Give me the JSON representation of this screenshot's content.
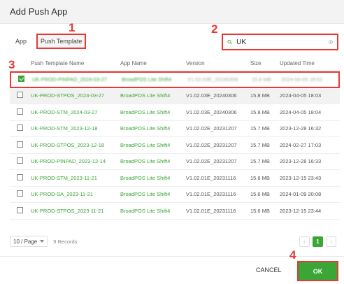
{
  "dialog": {
    "title": "Add Push App"
  },
  "tabs": [
    {
      "label": "App"
    },
    {
      "label": "Push Template"
    }
  ],
  "search": {
    "value": "UK"
  },
  "annotations": [
    "1",
    "2",
    "3",
    "4"
  ],
  "table": {
    "headers": [
      "Push Template Name",
      "App Name",
      "Version",
      "Size",
      "Updated Time"
    ],
    "rows": [
      {
        "name": "UK-PROD-PINPAD_2024-03-27",
        "app": "BroadPOS Lite Shift4",
        "version": "V1.02.03E_20240306",
        "size": "15.6 MB",
        "time": "2024-04-05 18:02",
        "checked": true
      },
      {
        "name": "UK-PROD-STPOS_2024-03-27",
        "app": "BroadPOS Lite Shift4",
        "version": "V1.02.03E_20240306",
        "size": "15.8 MB",
        "time": "2024-04-05 18:03",
        "checked": false
      },
      {
        "name": "UK-PROD-STM_2024-03-27",
        "app": "BroadPOS Lite Shift4",
        "version": "V1.02.03E_20240306",
        "size": "15.8 MB",
        "time": "2024-04-05 18:04",
        "checked": false
      },
      {
        "name": "UK-PROD-STM_2023-12-18",
        "app": "BroadPOS Lite Shift4",
        "version": "V1.02.02E_20231207",
        "size": "15.7 MB",
        "time": "2023-12-28 16:32",
        "checked": false
      },
      {
        "name": "UK-PROD-STPOS_2023-12-18",
        "app": "BroadPOS Lite Shift4",
        "version": "V1.02.02E_20231207",
        "size": "15.7 MB",
        "time": "2024-02-27 17:03",
        "checked": false
      },
      {
        "name": "UK-PROD-PINPAD_2023-12-14",
        "app": "BroadPOS Lite Shift4",
        "version": "V1.02.02E_20231207",
        "size": "15.7 MB",
        "time": "2023-12-28 16:33",
        "checked": false
      },
      {
        "name": "UK-PROD-STM_2023-11-21",
        "app": "BroadPOS Lite Shift4",
        "version": "V1.02.01E_20231116",
        "size": "15.6 MB",
        "time": "2023-12-15 23:43",
        "checked": false
      },
      {
        "name": "UK-PROD-SA_2023-11-21",
        "app": "BroadPOS Lite Shift4",
        "version": "V1.02.01E_20231116",
        "size": "15.6 MB",
        "time": "2024-01-09 20:08",
        "checked": false
      },
      {
        "name": "UK-PROD-STPOS_2023-11-21",
        "app": "BroadPOS Lite Shift4",
        "version": "V1.02.01E_20231116",
        "size": "15.6 MB",
        "time": "2023-12-15 23:44",
        "checked": false
      }
    ]
  },
  "pagination": {
    "per_page": "10 / Page",
    "records": "9 Records",
    "current_page": "1",
    "prev": "‹",
    "next": "›"
  },
  "footer": {
    "cancel": "CANCEL",
    "ok": "OK"
  },
  "colors": {
    "accent": "#3aa635",
    "annotation": "#e53935"
  }
}
